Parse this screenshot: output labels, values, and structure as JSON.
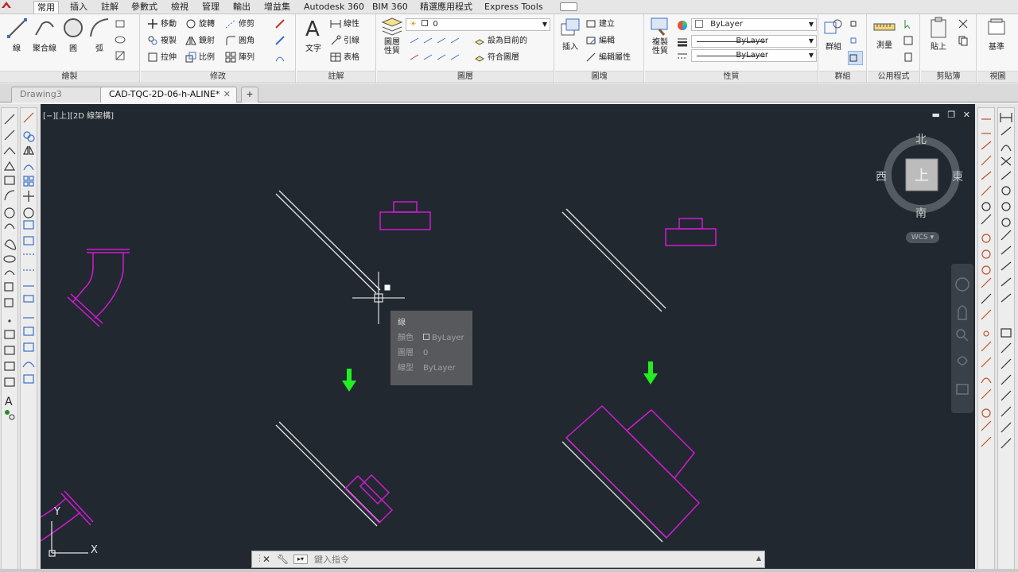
{
  "ribbon_tabs": [
    "常用",
    "插入",
    "註解",
    "參數式",
    "檢視",
    "管理",
    "輸出",
    "增益集",
    "Autodesk 360",
    "BIM 360",
    "精選應用程式",
    "Express Tools"
  ],
  "ribbon": {
    "draw": {
      "title": "繪製",
      "line": "線",
      "polyline": "聚合線",
      "circle": "圓",
      "arc": "弧"
    },
    "modify": {
      "title": "修改",
      "move": "移動",
      "rotate": "旋轉",
      "trim": "修剪",
      "copy": "複製",
      "mirror": "鏡射",
      "fillet": "圓角",
      "stretch": "拉伸",
      "scale": "比例",
      "array": "陣列"
    },
    "annotation": {
      "title": "註解",
      "text": "文字",
      "linear": "線性",
      "leader": "引線",
      "table": "表格"
    },
    "layers": {
      "title": "圖層",
      "layer_props": "圖層\n性質",
      "current_layer": "0",
      "set_current": "設為目前的",
      "match_layer": "符合圖層"
    },
    "block": {
      "title": "圖塊",
      "insert": "插入",
      "create": "建立",
      "edit": "編輯",
      "edit_attr": "編輯屬性"
    },
    "properties": {
      "title": "性質",
      "match_props": "複製\n性質",
      "color": "ByLayer",
      "linetype": "ByLayer",
      "lineweight": "ByLayer"
    },
    "groups": {
      "title": "群組",
      "group": "群組"
    },
    "utilities": {
      "title": "公用程式",
      "measure": "測量"
    },
    "clipboard": {
      "title": "剪貼簿",
      "paste": "貼上"
    },
    "view": {
      "title": "視圖",
      "base": "基準"
    }
  },
  "doc_tabs": [
    "Drawing3",
    "CAD-TQC-2D-06-h-ALINE*"
  ],
  "viewport_label": "[−][上][2D 線架構]",
  "viewcube": {
    "north": "北",
    "south": "南",
    "east": "東",
    "west": "西",
    "top": "上",
    "wcs": "WCS"
  },
  "tooltip": {
    "title": "線",
    "color_label": "顏色",
    "color_value": "ByLayer",
    "layer_label": "圖層",
    "layer_value": "0",
    "linetype_label": "線型",
    "linetype_value": "ByLayer"
  },
  "ucs": {
    "x": "X",
    "y": "Y"
  },
  "command": {
    "placeholder": "鍵入指令"
  },
  "colors": {
    "canvas": "#212830",
    "magenta": "#d01bd0",
    "green_arrow": "#22ee22",
    "white_line": "#e8e8e8"
  }
}
